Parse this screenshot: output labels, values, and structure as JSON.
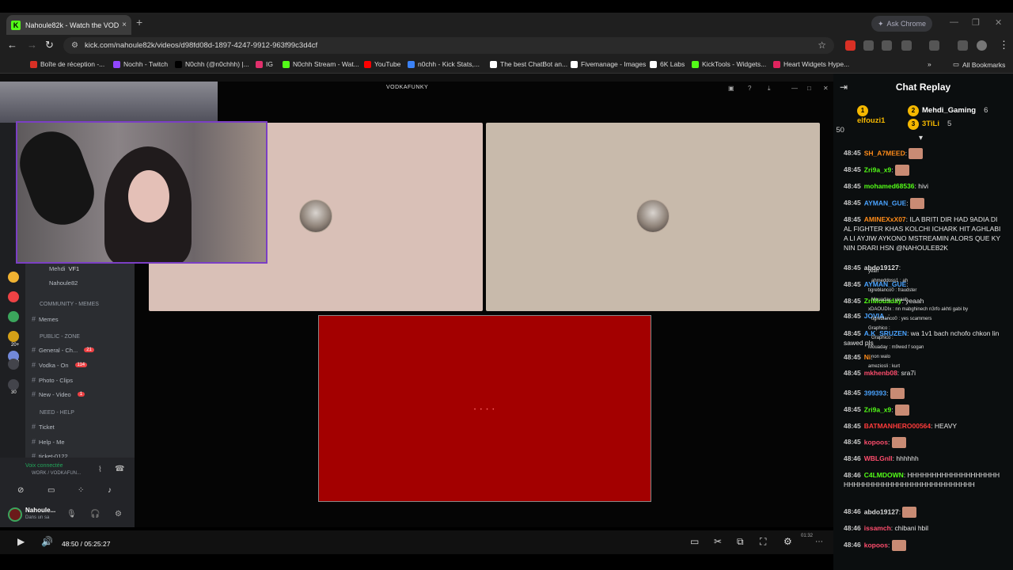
{
  "browser": {
    "tab_title": "Nahoule82k - Watch the VOD o",
    "tab_close": "×",
    "new_tab": "+",
    "ask_chrome": "Ask Chrome",
    "url": "kick.com/nahoule82k/videos/d98fd08d-1897-4247-9912-963f99c3d4cf",
    "bookmarks": [
      {
        "label": "Boîte de réception -...",
        "color": "#d93025"
      },
      {
        "label": "Nochh - Twitch",
        "color": "#9146ff"
      },
      {
        "label": "N0chh (@n0chhh) |...",
        "color": "#000000"
      },
      {
        "label": "IG",
        "color": "#e1306c"
      },
      {
        "label": "N0chh Stream - Wat...",
        "color": "#53fc18"
      },
      {
        "label": "YouTube",
        "color": "#ff0000"
      },
      {
        "label": "n0chh - Kick Stats,...",
        "color": "#3b82f6"
      },
      {
        "label": "The best ChatBot an...",
        "color": "#ffffff"
      },
      {
        "label": "Fivemanage - Images",
        "color": "#ffffff"
      },
      {
        "label": "6K Labs",
        "color": "#ffffff"
      },
      {
        "label": "KickTools - Widgets...",
        "color": "#53fc18"
      },
      {
        "label": "Heart Widgets Hype...",
        "color": "#e0245e"
      }
    ],
    "all_bookmarks": "All Bookmarks"
  },
  "stream": {
    "popup_title": "VODKAFUNKY",
    "loading_text": "• • • •",
    "current_time": "48:50 / 05:25:27",
    "progress_fraction": 0.15,
    "tray_time": "01:32"
  },
  "discord": {
    "voice_user1": "Mehdi",
    "voice_user1_tag": "VF1",
    "voice_user2": "Nahoule82",
    "categories": [
      "COMMUNITY - MEMES",
      "PUBLIC - ZONE",
      "NEED - HELP"
    ],
    "channels": [
      {
        "label": "Memes",
        "badge": ""
      },
      {
        "label": "General - Ch...",
        "badge": "21"
      },
      {
        "label": "Vodka - On",
        "badge": "114"
      },
      {
        "label": "Photo - Clips",
        "badge": ""
      },
      {
        "label": "New - Video",
        "badge": "1"
      },
      {
        "label": "Ticket",
        "badge": ""
      },
      {
        "label": "Help - Me",
        "badge": ""
      },
      {
        "label": "ticket-0122",
        "badge": ""
      }
    ],
    "voice_connected": "Voix connectée",
    "voice_channel": "WORK / VODKAFUN...",
    "user_name": "Nahoule...",
    "user_status": "Dans un sa",
    "server_badges": [
      "388",
      "30",
      "20+"
    ]
  },
  "chat": {
    "title": "Chat Replay",
    "leaderboard": [
      {
        "rank": "1",
        "name": "elfouzi1",
        "count": "50",
        "color": "#f5b800"
      },
      {
        "rank": "2",
        "name": "Mehdi_Gaming",
        "count": "6",
        "color": "#ffffff"
      },
      {
        "rank": "3",
        "name": "3TiLi",
        "count": "5",
        "color": "#f5b800"
      }
    ],
    "messages": [
      {
        "time": "48:45",
        "user": "SH_A7MEED",
        "color": "#ff8c1a",
        "text": "",
        "emote": true
      },
      {
        "time": "48:45",
        "user": "Zri9a_x9",
        "color": "#53fc18",
        "text": "",
        "emote": true
      },
      {
        "time": "48:45",
        "user": "mohamed68536",
        "color": "#53fc18",
        "text": "hivi",
        "emote": false
      },
      {
        "time": "48:45",
        "user": "AYMAN_GUE",
        "color": "#4aa3ff",
        "text": "",
        "emote": true
      },
      {
        "time": "48:45",
        "user": "AMINEXxX07",
        "color": "#ff8c1a",
        "text": "ILA BRITI DIR HAD 9ADIA DIAL FIGHTER KHAS KOLCHI ICHARK HIT AGHLABIA LI AYJIW AYKONO MSTREAMIN ALORS QUE KYNIN DRARI HSN @NAHOULEB2K",
        "emote": false
      },
      {
        "time": "48:45",
        "user": "abdo19127",
        "color": "#dddddd",
        "text": "",
        "emote": false
      },
      {
        "time": "48:45",
        "user": "AYMAN_GUE",
        "color": "#4aa3ff",
        "text": "",
        "emote": false
      },
      {
        "time": "48:45",
        "user": "ZriMouaday",
        "color": "#53fc18",
        "text": "yeaah",
        "emote": false
      },
      {
        "time": "48:45",
        "user": "JOVIA_",
        "color": "#4aa3ff",
        "text": "",
        "emote": false
      },
      {
        "time": "48:45",
        "user": "A.K_SRUZEN",
        "color": "#4aa3ff",
        "text": "wa 1v1 bach nchofo chkon linsawed pls",
        "emote": false
      },
      {
        "time": "48:45",
        "user": "Ni",
        "color": "#ff8c1a",
        "text": "",
        "emote": false
      },
      {
        "time": "48:45",
        "user": "mkhenb08",
        "color": "#ff4d6d",
        "text": "sra7i",
        "emote": false
      },
      {
        "time": "48:45",
        "user": "399393",
        "color": "#4aa3ff",
        "text": "",
        "emote": true
      },
      {
        "time": "48:45",
        "user": "Zri9a_x9",
        "color": "#53fc18",
        "text": "",
        "emote": true
      },
      {
        "time": "48:45",
        "user": "BATMANHERO00564",
        "color": "#ff3b3b",
        "text": "HEAVY",
        "emote": false
      },
      {
        "time": "48:45",
        "user": "kopoos",
        "color": "#ff4d6d",
        "text": "",
        "emote": true
      },
      {
        "time": "48:46",
        "user": "WBLGnII",
        "color": "#ff4d6d",
        "text": "hhhhhh",
        "emote": false
      },
      {
        "time": "48:46",
        "user": "C4LMDOWN",
        "color": "#53fc18",
        "text": "HHHHHHHHHHHHHHHHHHHHHHHHHHHHHHHHHHHHHHHHHHHHHH",
        "emote": false
      },
      {
        "time": "48:46",
        "user": "abdo19127",
        "color": "#dddddd",
        "text": "",
        "emote": true
      },
      {
        "time": "48:46",
        "user": "issamch",
        "color": "#ff4d6d",
        "text": "chibani hbil",
        "emote": false
      },
      {
        "time": "48:46",
        "user": "kopoos",
        "color": "#ff4d6d",
        "text": "",
        "emote": true
      }
    ],
    "overlay_lines": [
      "yeah",
      "ahmeddoss1 : ah",
      "tigreblanco0 : fraudster",
      "Mouaday : yeaah",
      "xDAOUDIx : nn mabghinech n3rfo akhti gabi by",
      "tigreblanco0 : yes scammers",
      "Graphico : ",
      "Graphico : ",
      "Mouaday : m9wed f sogan",
      "non walo",
      "ameziosli : kurt"
    ]
  }
}
